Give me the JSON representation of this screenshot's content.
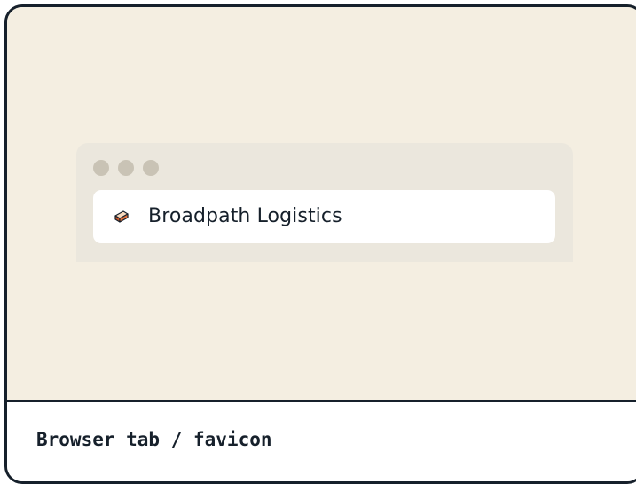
{
  "browser": {
    "window_controls": [
      "dot",
      "dot",
      "dot"
    ],
    "tab": {
      "favicon": "brick-icon",
      "title": "Broadpath Logistics"
    }
  },
  "caption": {
    "label": "Browser tab / favicon"
  },
  "colors": {
    "background": "#f4eee1",
    "frame": "#ebe7dd",
    "dot": "#c9c3b5",
    "ink": "#16202b",
    "favicon_orange": "#e2703a"
  }
}
